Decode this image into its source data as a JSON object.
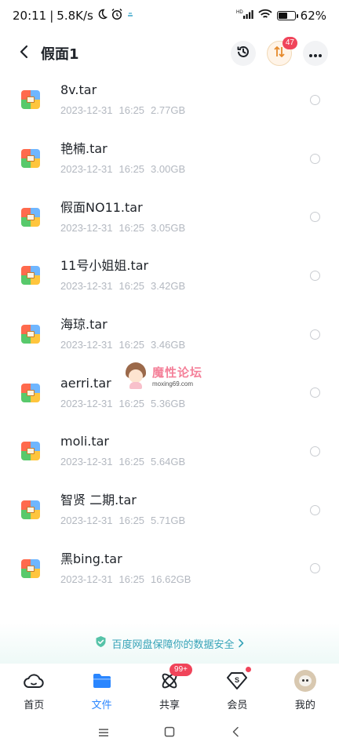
{
  "status_bar": {
    "time": "20:11",
    "network_speed": "5.8K/s",
    "battery_percent": "62%",
    "battery_level": 0.62,
    "signal_label": "HD"
  },
  "header": {
    "title": "假面1",
    "transfer_badge": "47"
  },
  "files": [
    {
      "name": "8v.tar",
      "date": "2023-12-31",
      "time": "16:25",
      "size": "2.77GB"
    },
    {
      "name": "艳楠.tar",
      "date": "2023-12-31",
      "time": "16:25",
      "size": "3.00GB"
    },
    {
      "name": "假面NO11.tar",
      "date": "2023-12-31",
      "time": "16:25",
      "size": "3.05GB"
    },
    {
      "name": "11号小姐姐.tar",
      "date": "2023-12-31",
      "time": "16:25",
      "size": "3.42GB"
    },
    {
      "name": "海琼.tar",
      "date": "2023-12-31",
      "time": "16:25",
      "size": "3.46GB"
    },
    {
      "name": "aerri.tar",
      "date": "2023-12-31",
      "time": "16:25",
      "size": "5.36GB"
    },
    {
      "name": "moli.tar",
      "date": "2023-12-31",
      "time": "16:25",
      "size": "5.64GB"
    },
    {
      "name": "智贤 二期.tar",
      "date": "2023-12-31",
      "time": "16:25",
      "size": "5.71GB"
    },
    {
      "name": "黑bing.tar",
      "date": "2023-12-31",
      "time": "16:25",
      "size": "16.62GB"
    }
  ],
  "watermark": {
    "title": "魔性论坛",
    "url": "moxing69.com"
  },
  "security_banner": {
    "text": "百度网盘保障你的数据安全"
  },
  "bottom_nav": {
    "items": [
      {
        "label": "首页",
        "icon": "cloud-icon"
      },
      {
        "label": "文件",
        "icon": "folder-icon",
        "active": true
      },
      {
        "label": "共享",
        "icon": "share-atom-icon",
        "badge": "99+"
      },
      {
        "label": "会员",
        "icon": "vip-diamond-icon"
      },
      {
        "label": "我的",
        "icon": "avatar"
      }
    ]
  },
  "colors": {
    "accent": "#2a86ff",
    "badge": "#f0445a",
    "meta_text": "#b3b8c0",
    "security_text": "#37a3b8"
  }
}
